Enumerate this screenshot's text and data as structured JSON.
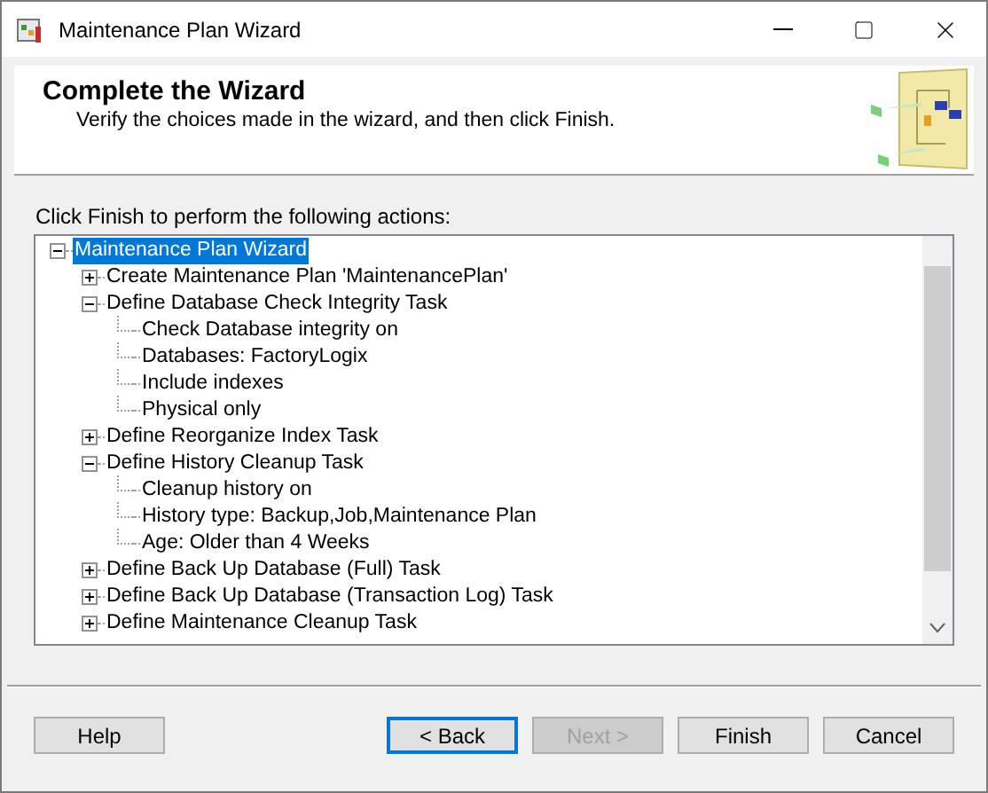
{
  "window": {
    "title": "Maintenance Plan Wizard"
  },
  "header": {
    "title": "Complete the Wizard",
    "subtitle": "Verify the choices made in the wizard, and then click Finish."
  },
  "instructions": "Click Finish to perform the following actions:",
  "tree": {
    "label": "Maintenance Plan Wizard",
    "expanded": true,
    "selected": true,
    "children": [
      {
        "label": "Create Maintenance Plan 'MaintenancePlan'",
        "expanded": false,
        "selected": false
      },
      {
        "label": "Define Database Check Integrity Task",
        "expanded": true,
        "selected": false,
        "children": [
          {
            "label": "Check Database integrity on",
            "selected": false
          },
          {
            "label": "Databases: FactoryLogix",
            "selected": false
          },
          {
            "label": "Include indexes",
            "selected": false
          },
          {
            "label": "Physical only",
            "selected": false
          }
        ]
      },
      {
        "label": "Define Reorganize Index Task",
        "expanded": false,
        "selected": false
      },
      {
        "label": "Define History Cleanup Task",
        "expanded": true,
        "selected": false,
        "children": [
          {
            "label": "Cleanup history on",
            "selected": false
          },
          {
            "label": "History type: Backup,Job,Maintenance Plan",
            "selected": false
          },
          {
            "label": "Age: Older than 4 Weeks",
            "selected": false
          }
        ]
      },
      {
        "label": "Define Back Up Database (Full) Task",
        "expanded": false,
        "selected": false
      },
      {
        "label": "Define Back Up Database (Transaction Log) Task",
        "expanded": false,
        "selected": false
      },
      {
        "label": "Define Maintenance Cleanup Task",
        "expanded": false,
        "selected": false
      }
    ]
  },
  "buttons": [
    {
      "label": "Help",
      "disabled": false,
      "focused": false
    },
    {
      "label": "< Back",
      "disabled": false,
      "focused": true
    },
    {
      "label": "Next >",
      "disabled": true,
      "focused": false
    },
    {
      "label": "Finish",
      "disabled": false,
      "focused": false
    },
    {
      "label": "Cancel",
      "disabled": false,
      "focused": false
    }
  ]
}
